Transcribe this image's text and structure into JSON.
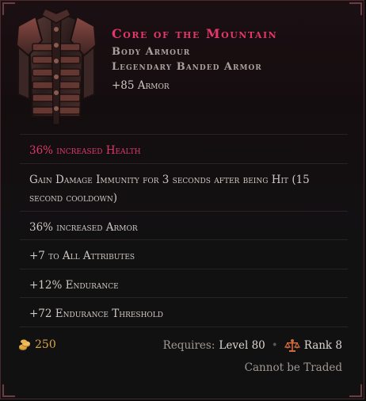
{
  "item": {
    "name": "Core of the Mountain",
    "slot": "Body Armour",
    "base_type": "Legendary Banded Armor",
    "base_stat": "+85 Armor",
    "rarity_color": "#e0386a",
    "image_icon": "banded-armor-icon"
  },
  "affixes": [
    {
      "text": "36% increased Health",
      "highlight": true
    },
    {
      "text": "Gain Damage Immunity for 3 seconds after being Hit (15 second cooldown)",
      "highlight": false
    },
    {
      "text": "36% increased Armor",
      "highlight": false
    },
    {
      "text": "+7 to All Attributes",
      "highlight": false
    },
    {
      "text": "+12% Endurance",
      "highlight": false
    },
    {
      "text": "+72 Endurance Threshold",
      "highlight": false
    }
  ],
  "footer": {
    "gold_icon": "gold-coins-icon",
    "gold_value": "250",
    "requires_label": "Requires:",
    "requires_value": "Level 80",
    "rank_icon": "faction-scales-icon",
    "rank_value": "Rank 8",
    "trade_note": "Cannot be Traded"
  }
}
